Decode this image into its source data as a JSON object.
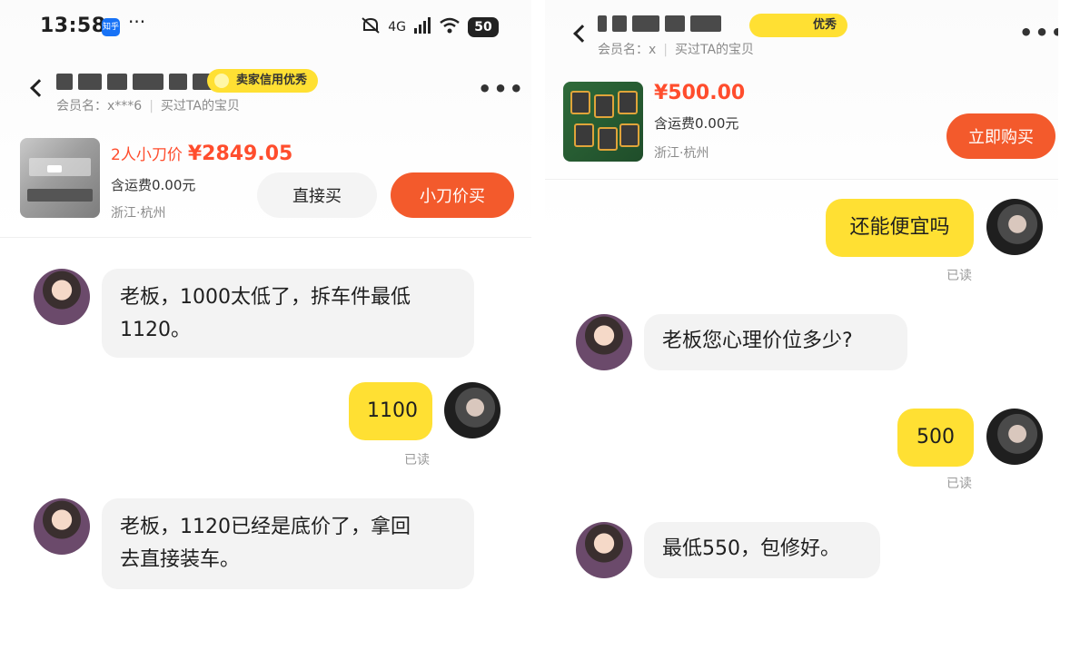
{
  "left": {
    "status_bar": {
      "time": "13:58",
      "app_badge": "知乎",
      "more": "···",
      "network": "4G",
      "battery": "50",
      "icons": [
        "mute-icon",
        "signal-icon",
        "wifi-icon",
        "battery-icon"
      ]
    },
    "header": {
      "credit_badge": "卖家信用优秀",
      "member_name": "会员名：x***6",
      "bought_link": "买过TA的宝贝",
      "more": "•••"
    },
    "product": {
      "price_prefix": "2人小刀价",
      "price": "¥2849.05",
      "shipping": "含运费0.00元",
      "location": "浙江·杭州",
      "buy_now": "直接买",
      "bargain_buy": "小刀价买"
    },
    "messages": [
      {
        "from": "seller",
        "text_line1": "老板，1000太低了，拆车件最低",
        "text_line2": "1120。"
      },
      {
        "from": "buyer",
        "text": "1100",
        "status": "已读"
      },
      {
        "from": "seller",
        "text_line1": "老板，1120已经是底价了，拿回",
        "text_line2": "去直接装车。"
      }
    ]
  },
  "right": {
    "header": {
      "credit_badge": "优秀",
      "member_name": "会员名：x",
      "bought_link": "买过TA的宝贝",
      "more": "•••"
    },
    "product": {
      "price": "¥500.00",
      "shipping": "含运费0.00元",
      "location": "浙江·杭州",
      "buy_now": "立即购买"
    },
    "messages": [
      {
        "from": "buyer",
        "text": "还能便宜吗",
        "status": "已读"
      },
      {
        "from": "seller",
        "text": "老板您心理价位多少?"
      },
      {
        "from": "buyer",
        "text": "500",
        "status": "已读"
      },
      {
        "from": "seller",
        "text": "最低550，包修好。"
      }
    ]
  },
  "colors": {
    "accent_orange": "#f35a2c",
    "price_red": "#ff4d2d",
    "bubble_yellow": "#ffe033",
    "bubble_gray": "#f3f3f3"
  }
}
